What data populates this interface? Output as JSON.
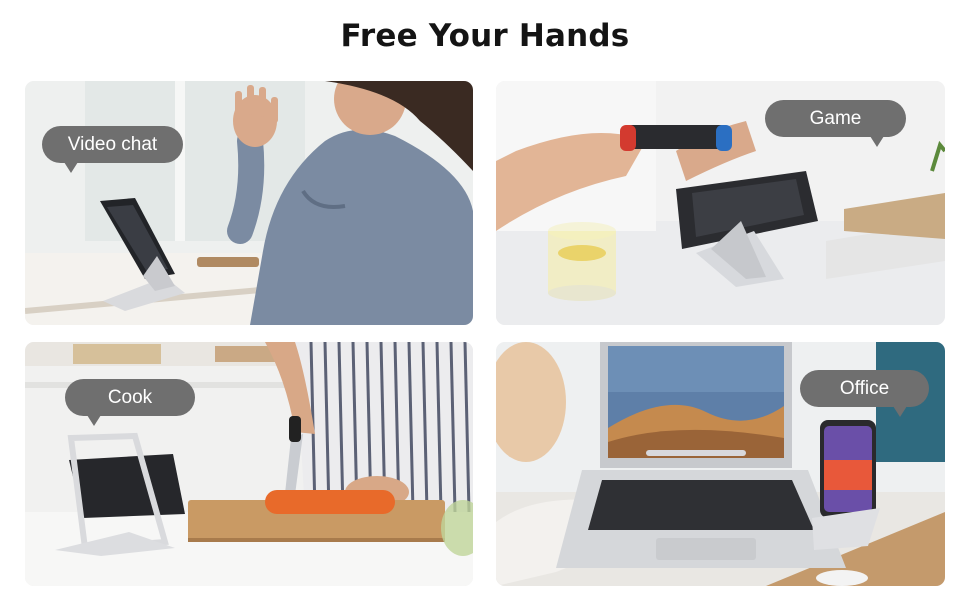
{
  "page": {
    "title": "Free Your Hands"
  },
  "scenes": [
    {
      "label": "Video chat"
    },
    {
      "label": "Game"
    },
    {
      "label": "Cook"
    },
    {
      "label": "Office"
    }
  ]
}
